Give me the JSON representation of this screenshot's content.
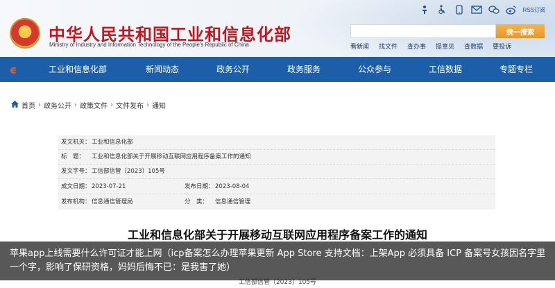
{
  "header": {
    "title": "中华人民共和国工业和信息化部",
    "subtitle": "Ministry of Industry and Information Technology of the People's Republic of China",
    "rss_label": "RSS订阅",
    "search": {
      "placeholder": "",
      "button_label": "统一搜索"
    },
    "quick_links": [
      "看新闻",
      "找文件",
      "查办事",
      "提意见",
      "查数据",
      "要投诉"
    ]
  },
  "nav": {
    "items": [
      "工业和信息化部",
      "新闻动态",
      "政务公开",
      "政务服务",
      "公众参与",
      "工信数据",
      "专题专栏"
    ]
  },
  "breadcrumb": [
    "首页",
    "政务公开",
    "政策文件",
    "文件发布",
    "通知"
  ],
  "doc_info": {
    "issuer_label": "发文机关：",
    "issuer": "工业和信息化部",
    "title_label": "标　题：",
    "title": "工业和信息化部关于开展移动互联网应用程序备案工作的通知",
    "number_label": "发文字号：",
    "number": "工信部信管〔2023〕105号",
    "created_label": "成文日期：",
    "created": "2023-07-21",
    "published_label": "发布日期：",
    "published": "2023-08-04",
    "org_label": "发布机构：",
    "org": "信息通信管理局",
    "category_label": "分　类：",
    "category": "信息通信管理"
  },
  "document": {
    "title": "工业和信息化部关于开展移动互联网应用程序备案工作的通知",
    "number": "工信部信管〔2023〕105号"
  },
  "overlay": {
    "text": "苹果app上线需要什么许可证才能上网（icp备案怎么办理苹果更新 App Store 支持文档：上架App 必须具备 ICP 备案号女孩因名字里一个字，影响了保研资格，妈妈后悔不已：是我害了她）"
  },
  "colors": {
    "brand_red": "#c0171e",
    "nav_blue": "#1d5ea8",
    "search_orange": "#e8962a"
  }
}
